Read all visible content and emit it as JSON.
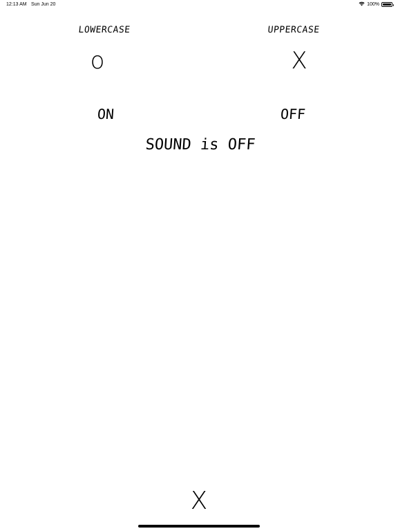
{
  "status_bar": {
    "time": "12:13 AM",
    "date": "Sun Jun 20",
    "battery_text": "100%",
    "battery_level": 1.0,
    "wifi_icon": "wifi-icon"
  },
  "case_options": {
    "lowercase_label": "LOWERCASE",
    "uppercase_label": "UPPERCASE",
    "lowercase_letter": "o",
    "uppercase_letter": "X"
  },
  "sound_toggle": {
    "on_label": "ON",
    "off_label": "OFF",
    "status_text": "SOUND is OFF"
  },
  "current_letter": "X"
}
